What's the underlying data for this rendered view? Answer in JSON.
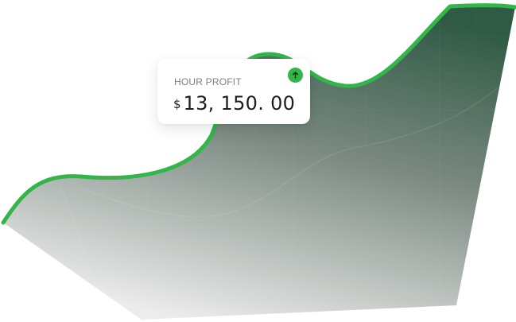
{
  "profit_card": {
    "label": "HOUR PROFIT",
    "currency": "$",
    "amount": "13, 150. 00",
    "trend_icon": "arrow-up-icon"
  },
  "colors": {
    "line": "#33b54a",
    "fill_top": "#2f5a44",
    "fill_bottom": "#e9e9e9",
    "badge": "#33b54a"
  }
}
